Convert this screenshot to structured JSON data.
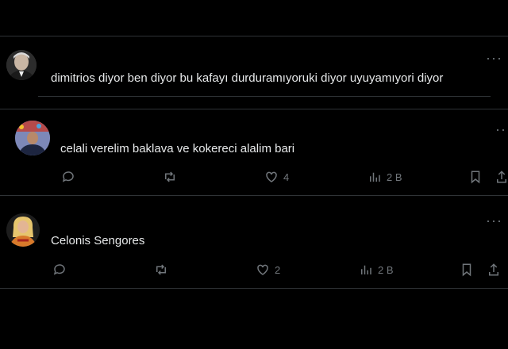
{
  "posts": [
    {
      "text": "dimitrios diyor ben diyor bu kafayı durduramıyoruki diyor uyuyamıyori diyor",
      "avatar": "avatar-man-gray-hair"
    },
    {
      "text": "celali verelim baklava ve  kokereci alalim bari",
      "avatar": "avatar-man-press-conference",
      "likes": "4",
      "views": "2 B"
    },
    {
      "text": "Celonis Sengores",
      "avatar": "avatar-woman-blonde",
      "likes": "2",
      "views": "2 B"
    }
  ],
  "icons": [
    "more-icon",
    "reply-icon",
    "repost-icon",
    "like-icon",
    "views-icon",
    "bookmark-icon",
    "share-icon"
  ],
  "colors": {
    "background": "#000000",
    "text": "#e7e9ea",
    "muted": "#71767b",
    "divider": "#2f3336"
  }
}
